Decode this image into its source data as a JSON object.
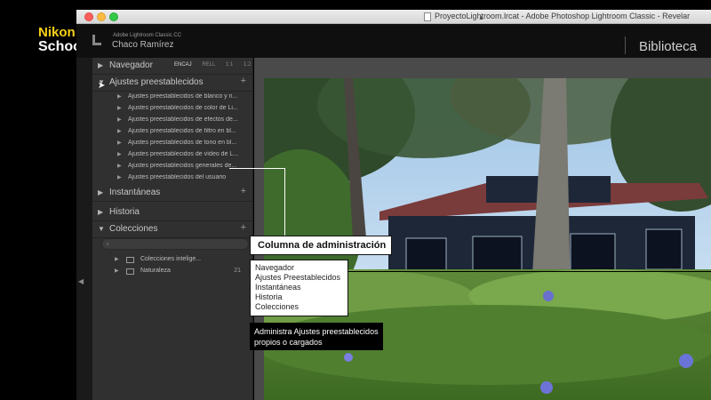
{
  "window": {
    "title": "ProyectoLightroom.lrcat - Adobe Photoshop Lightroom Classic - Revelar"
  },
  "lightroom": {
    "product": "Adobe Lightroom Classic CC",
    "user": "Chaco Ramírez",
    "module": "Biblioteca"
  },
  "logo": {
    "line1": "Nikon",
    "line2": "School",
    "accent_color": "#f7d117"
  },
  "left_panel": {
    "navigator": {
      "title": "Navegador",
      "options": [
        "ENCAJ",
        "RELL",
        "1:1",
        "1:2"
      ],
      "active_option": "ENCAJ"
    },
    "presets": {
      "title": "Ajustes preestablecidos",
      "items": [
        "Ajustes preestablecidos de blanco y n...",
        "Ajustes preestablecidos de color de Li...",
        "Ajustes preestablecidos de efectos de...",
        "Ajustes preestablecidos de filtro en bl...",
        "Ajustes preestablecidos de tono en bl...",
        "Ajustes preestablecidos de vídeo de L...",
        "Ajustes preestablecidos generales de...",
        "Ajustes preestablecidos del usuario"
      ]
    },
    "snapshots": {
      "title": "Instantáneas"
    },
    "history": {
      "title": "Historia"
    },
    "collections": {
      "title": "Colecciones",
      "items": [
        {
          "label": "Colecciones intelige...",
          "count": ""
        },
        {
          "label": "Naturaleza",
          "count": "21"
        }
      ]
    },
    "plus_glyph": "+"
  },
  "callouts": {
    "title": "Columna de administración",
    "list": [
      "Navegador",
      "Ajustes Preestablecidos",
      "Instantáneas",
      "Historia",
      "Colecciones"
    ],
    "description": "Administra Ajustes preestablecidos propios o cargados"
  }
}
